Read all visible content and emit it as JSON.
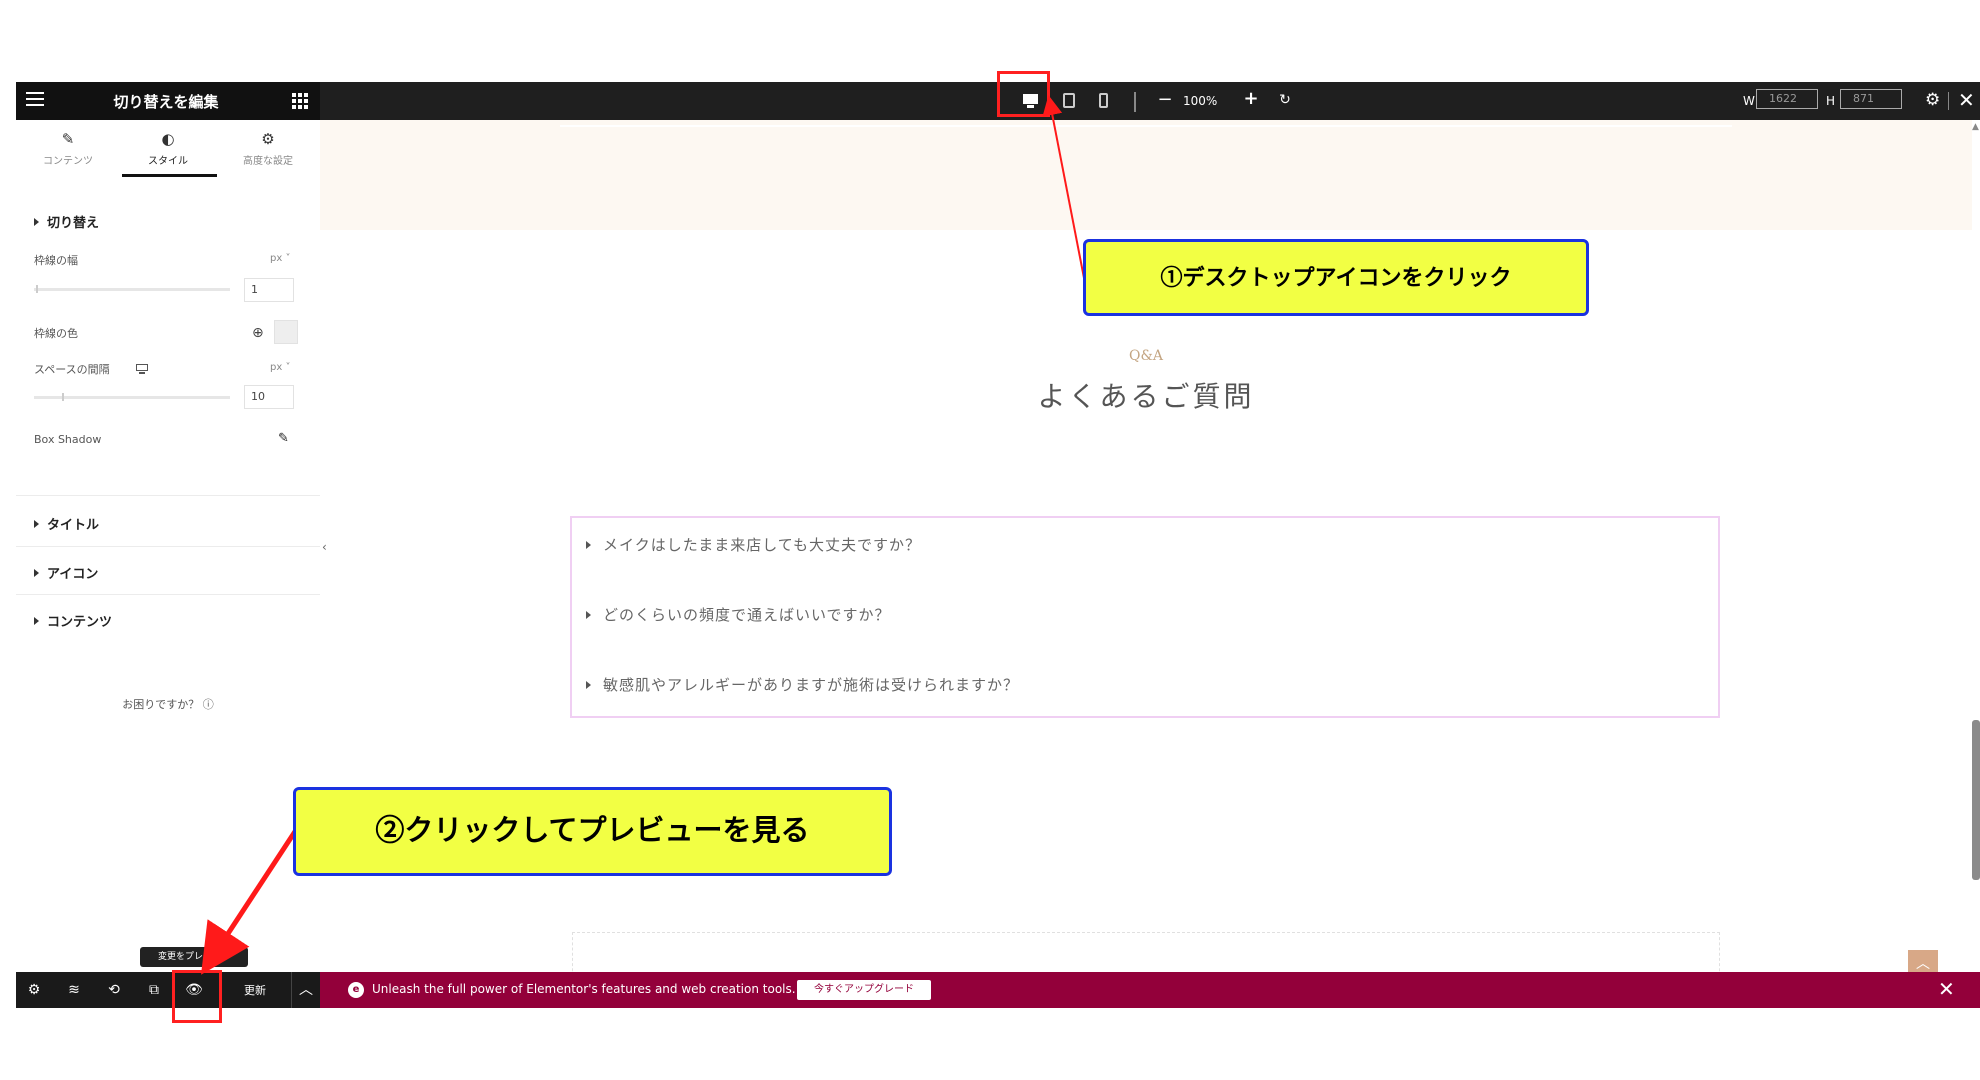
{
  "topbar": {
    "panel_title": "切り替えを編集",
    "zoom_level": "100%",
    "zoom_minus": "−",
    "zoom_plus": "+",
    "zoom_reset": "↻",
    "width_label": "W",
    "width_value": "1622",
    "height_label": "H",
    "height_value": "871",
    "settings_glyph": "⚙",
    "close_glyph": "✕"
  },
  "panel": {
    "tabs": [
      {
        "label": "コンテンツ",
        "icon": "pencil-icon",
        "glyph": "✎"
      },
      {
        "label": "スタイル",
        "icon": "contrast-icon",
        "glyph": "◐"
      },
      {
        "label": "高度な設定",
        "icon": "gear-icon",
        "glyph": "⚙"
      }
    ],
    "section_toggle": "切り替え",
    "border_width_label": "枠線の幅",
    "border_width_unit": "px ˅",
    "border_width_value": "1",
    "border_color_label": "枠線の色",
    "spacing_label": "スペースの間隔",
    "spacing_unit": "px ˅",
    "spacing_value": "10",
    "box_shadow_label": "Box Shadow",
    "section_title": "タイトル",
    "section_icon": "アイコン",
    "section_content": "コンテンツ",
    "help_text": "お困りですか？ ⓘ",
    "collapse_glyph": "‹"
  },
  "canvas": {
    "qa_kicker": "Q&A",
    "qa_title": "よくあるご質問",
    "faq_items": [
      "メイクはしたまま来店しても大丈夫ですか？",
      "どのくらいの頻度で通えばいいですか？",
      "敏感肌やアレルギーがありますが施術は受けられますか？"
    ],
    "to_top_glyph": "︿"
  },
  "bottombar": {
    "update_label": "更新",
    "tooltip": "変更をプレビュー",
    "up_glyph": "︿",
    "icons": {
      "settings": "⚙",
      "layers": "≋",
      "history": "⟲",
      "responsive": "⧉",
      "preview": "👁"
    }
  },
  "promo": {
    "text": "Unleash the full power of Elementor's features and web creation tools.",
    "button": "今すぐアップグレード",
    "icon": "e",
    "close": "✕"
  },
  "annotations": {
    "callout1": "①デスクトップアイコンをクリック",
    "callout2": "②クリックしてプレビューを見る"
  },
  "colors": {
    "promo_bg": "#93003a",
    "callout_bg": "#f2ff44",
    "callout_border": "#1a32e0",
    "highlight": "#ff2020",
    "kicker": "#c4a582"
  }
}
